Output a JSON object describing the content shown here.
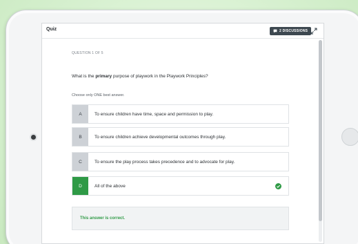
{
  "header": {
    "title": "Quiz",
    "discussions_label": "2 DISCUSSIONS"
  },
  "question": {
    "counter": "QUESTION 1 OF 5",
    "text_before": "What is the ",
    "text_bold": "primary",
    "text_after": " purpose of playwork in the Playwork Principles?",
    "instruction": "Choose only ONE best answer."
  },
  "options": [
    {
      "letter": "A",
      "label": "To ensure children have time, space and permission to play."
    },
    {
      "letter": "B",
      "label": "To ensure children achieve developmental outcomes through play."
    },
    {
      "letter": "C",
      "label": "To ensure the play process takes precedence and to advocate for play."
    },
    {
      "letter": "D",
      "label": "All of the above",
      "selected": true,
      "correct": true
    }
  ],
  "feedback": {
    "text": "This answer is correct."
  },
  "colors": {
    "correct": "#2f9a46",
    "discussion_button": "#3d4850",
    "option_letter_bg": "#cdd1d6"
  },
  "icons": {
    "discussions": "chat-bubble-icon",
    "expand": "expand-icon",
    "correct": "check-circle-icon"
  }
}
